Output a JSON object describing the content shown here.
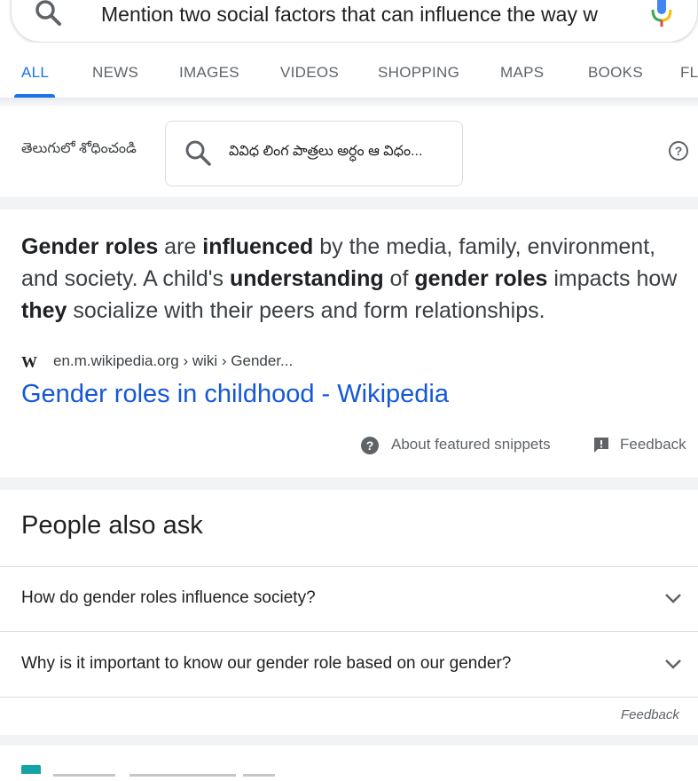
{
  "search": {
    "query": "Mention two social factors that can influence the way w"
  },
  "tabs": [
    "ALL",
    "NEWS",
    "IMAGES",
    "VIDEOS",
    "SHOPPING",
    "MAPS",
    "BOOKS",
    "FL"
  ],
  "telugu": {
    "label": "తెలుగులో శోధించండి",
    "query": "వివిధ లింగ పాత్రలు అర్ధం ఆ విధం..."
  },
  "snippet": {
    "parts": [
      {
        "t": "Gender roles",
        "b": true
      },
      {
        "t": " are ",
        "b": false
      },
      {
        "t": "influenced",
        "b": true
      },
      {
        "t": " by the media, family, environment, and society. A child's ",
        "b": false
      },
      {
        "t": "understanding",
        "b": true
      },
      {
        "t": " of ",
        "b": false
      },
      {
        "t": "gender roles",
        "b": true
      },
      {
        "t": " impacts how ",
        "b": false
      },
      {
        "t": "they",
        "b": true
      },
      {
        "t": " socialize with their peers and form relationships.",
        "b": false
      }
    ],
    "source_logo": "W",
    "source_url": "en.m.wikipedia.org › wiki › Gender...",
    "source_title": "Gender roles in childhood - Wikipedia",
    "about_label": "About featured snippets",
    "feedback_label": "Feedback"
  },
  "paa": {
    "title": "People also ask",
    "questions": [
      "How do gender roles influence society?",
      "Why is it important to know our gender role based on our gender?"
    ],
    "feedback_label": "Feedback"
  },
  "colors": {
    "accent": "#1a73e8",
    "link": "#1558d6",
    "band": "#f1f3f4"
  }
}
